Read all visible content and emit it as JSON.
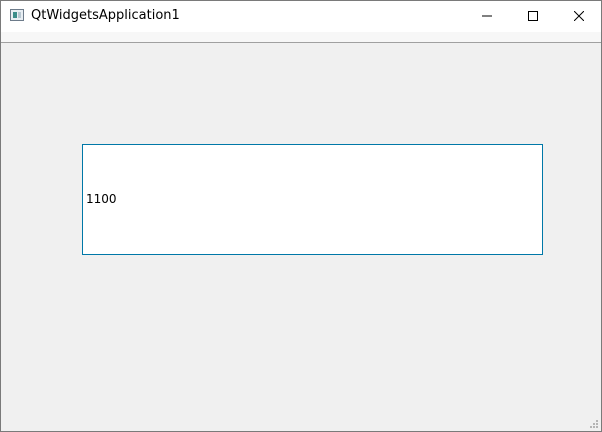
{
  "window": {
    "title": "QtWidgetsApplication1"
  },
  "titlebar": {
    "minimize_icon": "minimize-icon",
    "maximize_icon": "maximize-icon",
    "close_icon": "close-icon"
  },
  "central": {
    "input": {
      "value": "1100"
    }
  },
  "colors": {
    "focus_border": "#0078a8",
    "window_bg": "#f0f0f0",
    "titlebar_bg": "#ffffff"
  }
}
